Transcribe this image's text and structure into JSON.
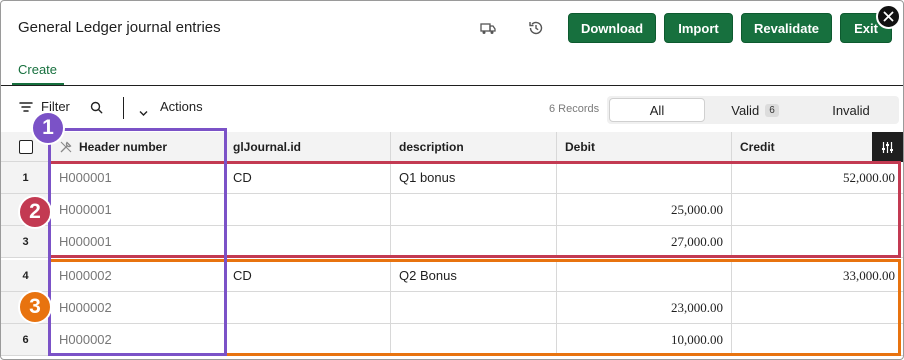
{
  "header": {
    "title": "General Ledger journal entries",
    "buttons": {
      "download": "Download",
      "import": "Import",
      "revalidate": "Revalidate",
      "exit": "Exit"
    },
    "brand_color": "#17703e"
  },
  "tabs": [
    {
      "label": "Create",
      "active": true
    }
  ],
  "toolbar": {
    "filter_label": "Filter",
    "actions_label": "Actions",
    "records_text": "6 Records",
    "segments": {
      "all": "All",
      "valid": "Valid",
      "valid_count": "6",
      "invalid": "Invalid"
    }
  },
  "table": {
    "columns": [
      "Header number",
      "glJournal.id",
      "description",
      "Debit",
      "Credit"
    ],
    "rows": [
      {
        "num": "1",
        "header": "H000001",
        "journal": "CD",
        "description": "Q1 bonus",
        "debit": "",
        "credit": "52,000.00"
      },
      {
        "num": "2",
        "header": "H000001",
        "journal": "",
        "description": "",
        "debit": "25,000.00",
        "credit": ""
      },
      {
        "num": "3",
        "header": "H000001",
        "journal": "",
        "description": "",
        "debit": "27,000.00",
        "credit": ""
      },
      {
        "num": "4",
        "header": "H000002",
        "journal": "CD",
        "description": "Q2 Bonus",
        "debit": "",
        "credit": "33,000.00"
      },
      {
        "num": "5",
        "header": "H000002",
        "journal": "",
        "description": "",
        "debit": "23,000.00",
        "credit": ""
      },
      {
        "num": "6",
        "header": "H000002",
        "journal": "",
        "description": "",
        "debit": "10,000.00",
        "credit": ""
      }
    ]
  },
  "annotations": {
    "markers": [
      "1",
      "2",
      "3"
    ],
    "colors": {
      "purple": "#7b52c7",
      "red": "#c33a52",
      "orange": "#e8730f"
    }
  }
}
